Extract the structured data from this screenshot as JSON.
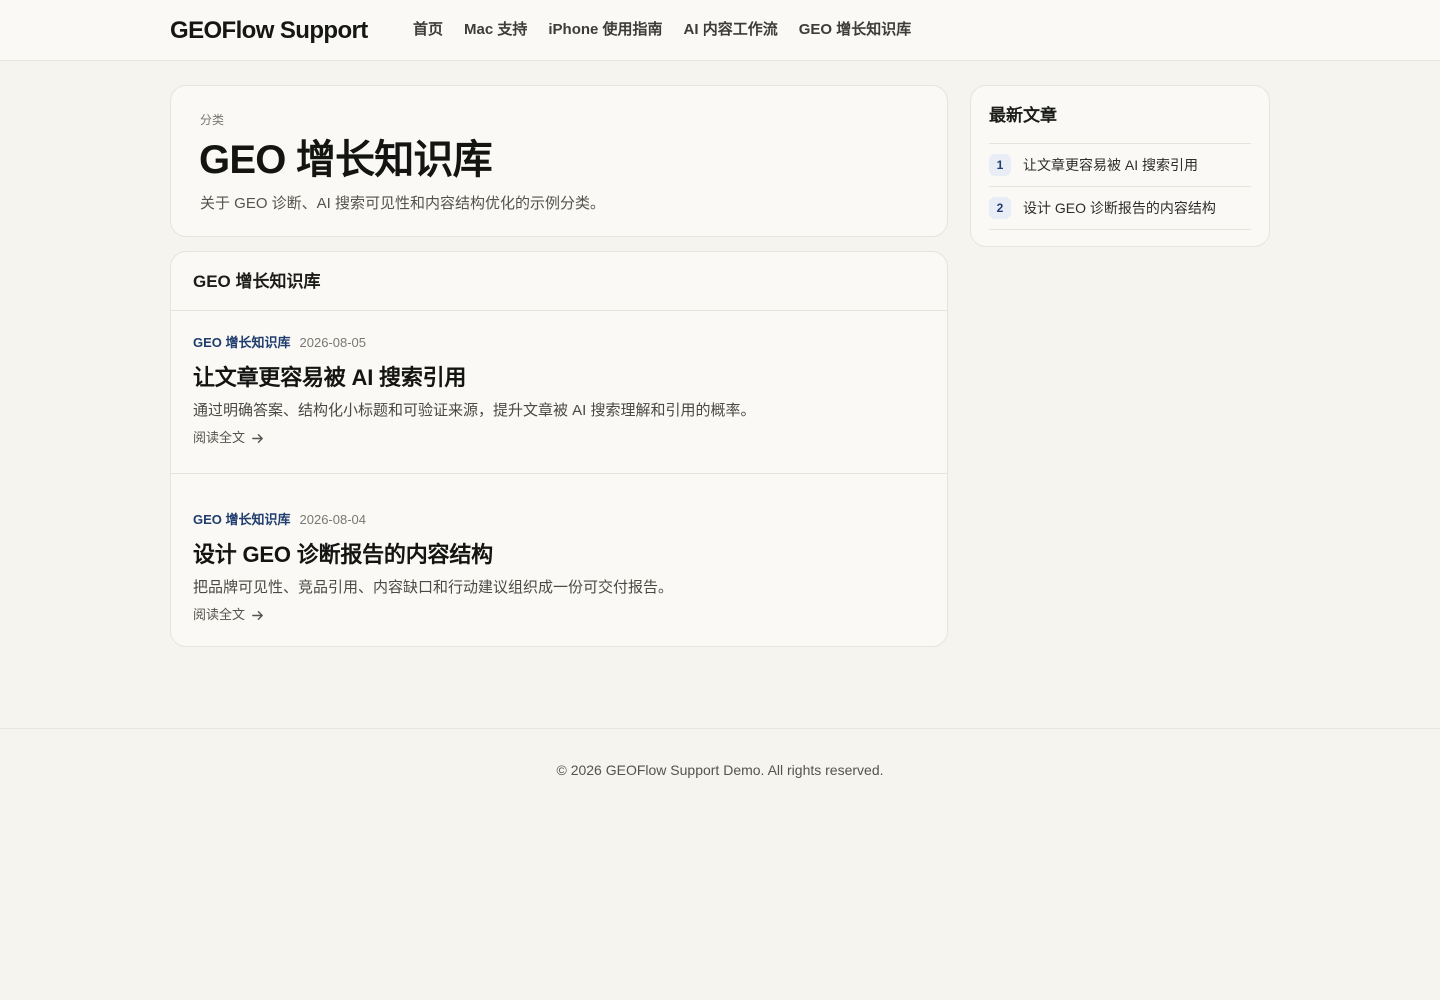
{
  "header": {
    "brand": "GEOFlow Support",
    "nav": [
      {
        "label": "首页"
      },
      {
        "label": "Mac 支持"
      },
      {
        "label": "iPhone 使用指南"
      },
      {
        "label": "AI 内容工作流"
      },
      {
        "label": "GEO 增长知识库"
      }
    ]
  },
  "hero": {
    "eyebrow": "分类",
    "title": "GEO 增长知识库",
    "description": "关于 GEO 诊断、AI 搜索可见性和内容结构优化的示例分类。"
  },
  "list": {
    "heading": "GEO 增长知识库",
    "articles": [
      {
        "category": "GEO 增长知识库",
        "date": "2026-08-05",
        "title": "让文章更容易被 AI 搜索引用",
        "excerpt": "通过明确答案、结构化小标题和可验证来源，提升文章被 AI 搜索理解和引用的概率。",
        "read_more": "阅读全文"
      },
      {
        "category": "GEO 增长知识库",
        "date": "2026-08-04",
        "title": "设计 GEO 诊断报告的内容结构",
        "excerpt": "把品牌可见性、竞品引用、内容缺口和行动建议组织成一份可交付报告。",
        "read_more": "阅读全文"
      }
    ]
  },
  "sidebar": {
    "title": "最新文章",
    "items": [
      {
        "num": "1",
        "title": "让文章更容易被 AI 搜索引用"
      },
      {
        "num": "2",
        "title": "设计 GEO 诊断报告的内容结构"
      }
    ]
  },
  "footer": {
    "text": "© 2026 GEOFlow Support Demo. All rights reserved."
  },
  "colors": {
    "background": "#f5f4ee",
    "surface": "#faf9f5",
    "accent": "#1f3d6e",
    "border": "#e6e4dc"
  },
  "icons": {
    "read_more": "arrow-right-icon"
  }
}
